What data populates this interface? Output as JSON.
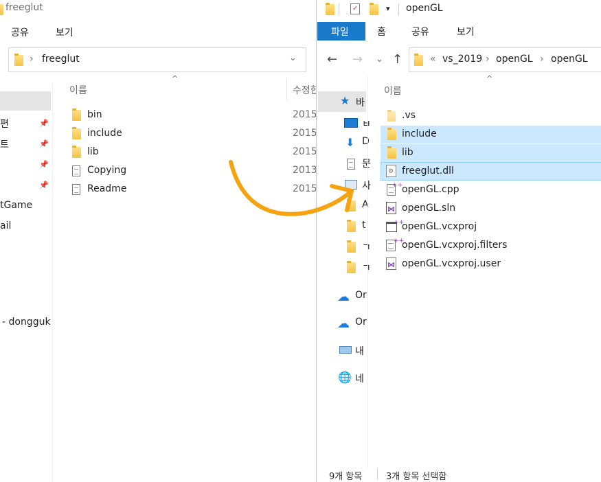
{
  "left": {
    "title": "freeglut",
    "menu": [
      "공유",
      "보기"
    ],
    "address": "freeglut",
    "col_name": "이름",
    "col_date": "수정한",
    "nav_fragments": [
      "편",
      "트",
      "tGame",
      "ail",
      "- dongguk"
    ],
    "files": [
      {
        "name": "bin",
        "date": "2015-",
        "kind": "folder"
      },
      {
        "name": "include",
        "date": "2015-",
        "kind": "folder"
      },
      {
        "name": "lib",
        "date": "2015-",
        "kind": "folder"
      },
      {
        "name": "Copying",
        "date": "2013-",
        "kind": "doc"
      },
      {
        "name": "Readme",
        "date": "2015-",
        "kind": "doc"
      }
    ]
  },
  "right": {
    "title": "openGL",
    "qat_dropdown": "▾",
    "tabs": [
      "파일",
      "홈",
      "공유",
      "보기"
    ],
    "breadcrumb": {
      "prefix": "«",
      "parts": [
        "vs_2019",
        "openGL",
        "openGL"
      ],
      "sep": "›"
    },
    "col_name": "이름",
    "nav_fragments": [
      "바",
      "ㅂ",
      "D",
      "문",
      "사",
      "A",
      "t",
      "ㄱ",
      "ㄱ",
      "Or",
      "Or",
      "내",
      "네"
    ],
    "files": [
      {
        "name": ".vs",
        "kind": "folder",
        "selected": false
      },
      {
        "name": "include",
        "kind": "folder",
        "selected": true
      },
      {
        "name": "lib",
        "kind": "folder",
        "selected": true
      },
      {
        "name": "freeglut.dll",
        "kind": "dll",
        "selected": true
      },
      {
        "name": "openGL.cpp",
        "kind": "cpp",
        "selected": false
      },
      {
        "name": "openGL.sln",
        "kind": "sln",
        "selected": false
      },
      {
        "name": "openGL.vcxproj",
        "kind": "vcx",
        "selected": false
      },
      {
        "name": "openGL.vcxproj.filters",
        "kind": "filters",
        "selected": false
      },
      {
        "name": "openGL.vcxproj.user",
        "kind": "user",
        "selected": false
      }
    ],
    "status_count": "9개 항목",
    "status_selected": "3개 항목 선택함"
  },
  "colors": {
    "accent": "#1979ca",
    "selection": "#cce8ff",
    "arrow": "#f5a30f"
  }
}
